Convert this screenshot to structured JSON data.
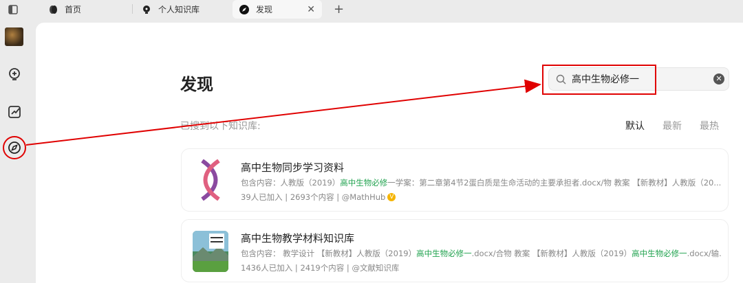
{
  "tabs": [
    {
      "label": "首页",
      "icon": "home-orb-icon"
    },
    {
      "label": "个人知识库",
      "icon": "bulb-icon"
    },
    {
      "label": "发现",
      "icon": "compass-icon",
      "active": true
    }
  ],
  "page": {
    "title": "发现",
    "search_value": "高中生物必修一",
    "found_label": "已搜到以下知识库:",
    "sort": [
      "默认",
      "最新",
      "最热"
    ],
    "sort_selected": "默认"
  },
  "cards": [
    {
      "title": "高中生物同步学习资料",
      "desc_prefix": "包含内容：人教版（2019）",
      "desc_hl": "高中生物必修",
      "desc_suffix": "一学案：第二章第4节2蛋白质是生命活动的主要承担者.docx/物  教案 【新教材】人教版（20...",
      "members": "39人已加入",
      "count": "2693个内容",
      "author": "@MathHub",
      "verified": "V"
    },
    {
      "title": "高中生物教学材料知识库",
      "desc_prefix": "包含内容： 教学设计 【新教材】人教版（2019）",
      "desc_hl": "高中生物必修一",
      "desc_mid": ".docx/合物 教案 【新教材】人教版（2019）",
      "desc_hl2": "高中生物必修一",
      "desc_suffix": ".docx/输...",
      "members": "1436人已加入",
      "count": "2419个内容",
      "author": "@文献知识库"
    }
  ],
  "colors": {
    "annotation": "#e00000",
    "highlight": "#22a350"
  }
}
